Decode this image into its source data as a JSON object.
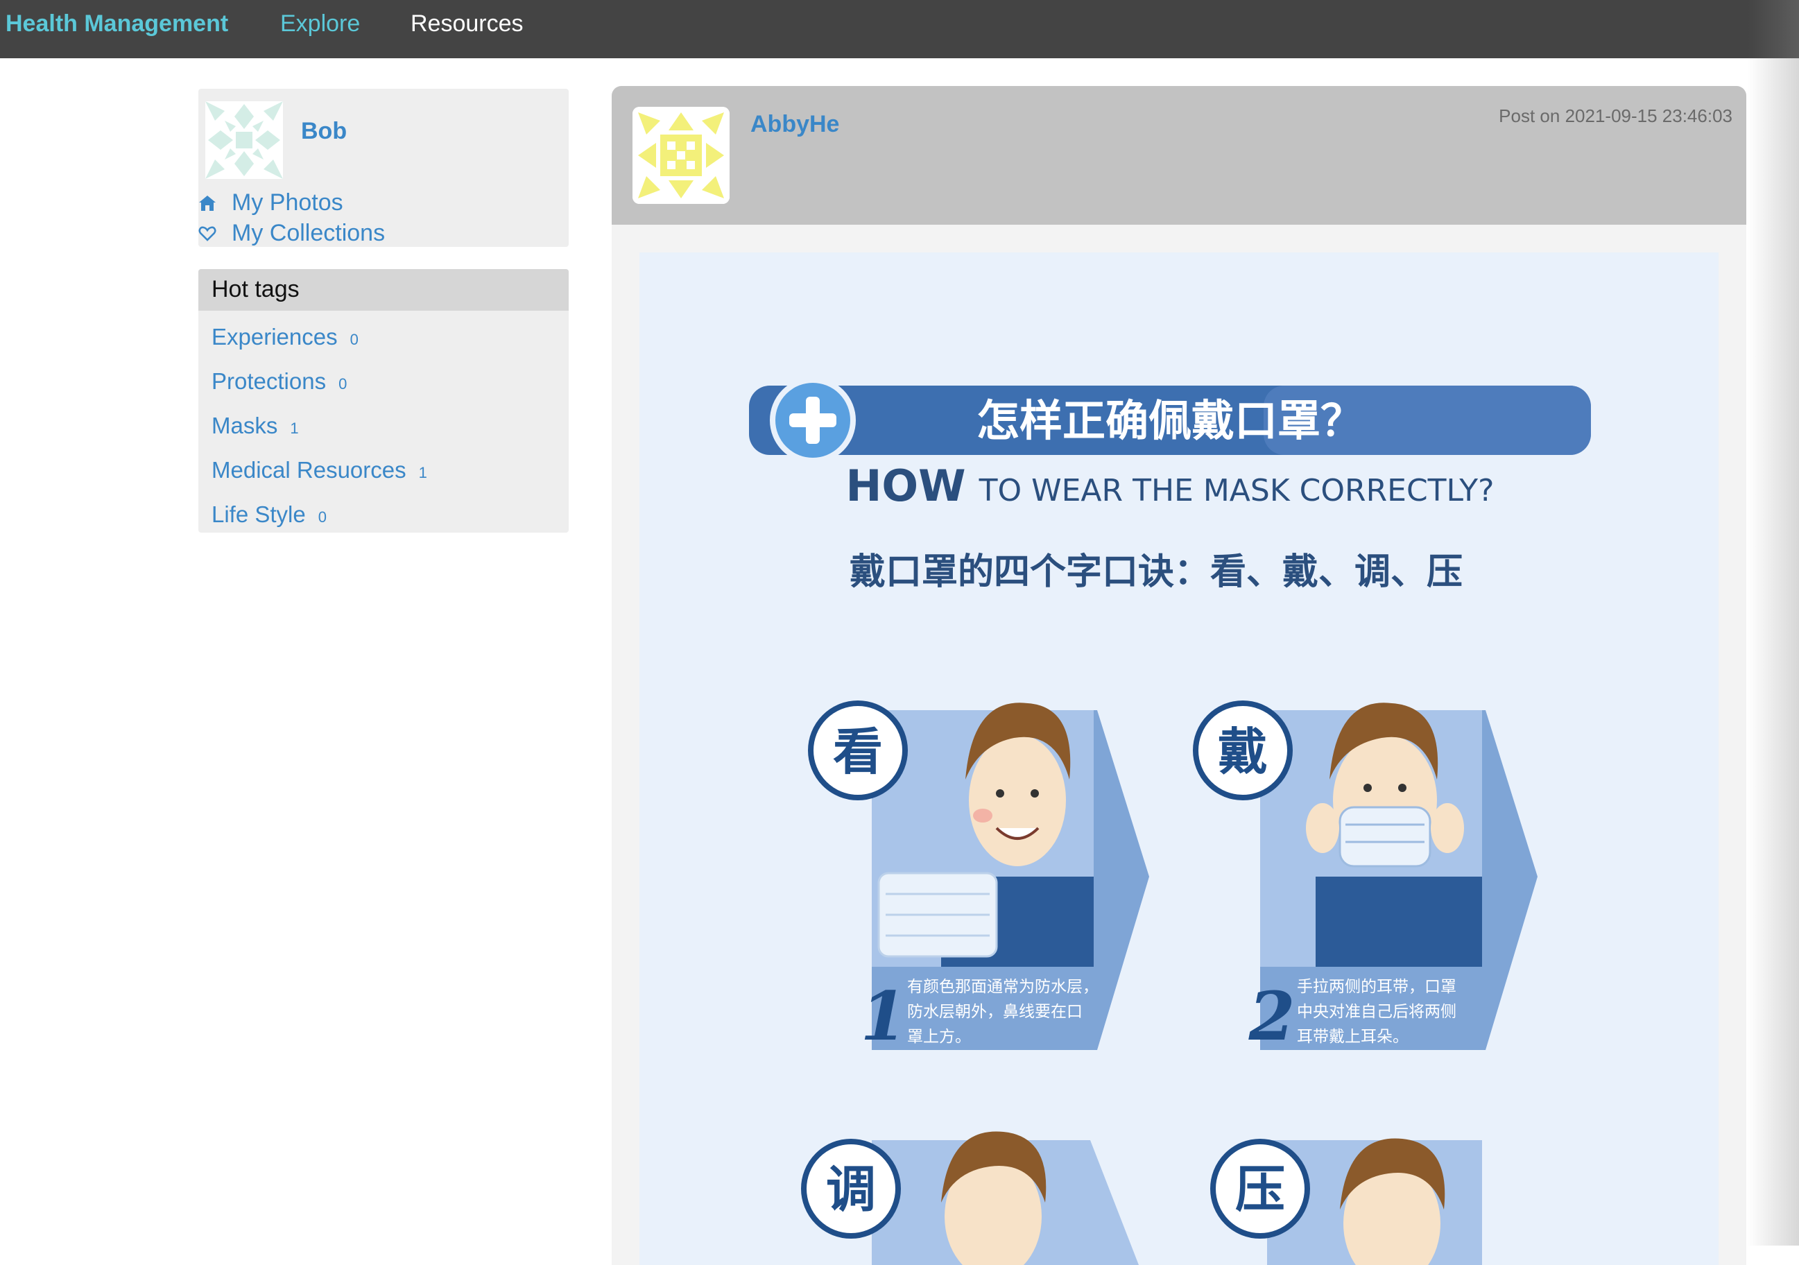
{
  "nav": {
    "brand": "Health Management",
    "items": [
      {
        "label": "Explore"
      },
      {
        "label": "Resources"
      }
    ]
  },
  "sidebar": {
    "user": {
      "name": "Bob"
    },
    "links": [
      {
        "label": "My Photos",
        "icon": "home-icon"
      },
      {
        "label": "My Collections",
        "icon": "heart-icon"
      }
    ],
    "hot_tags": {
      "title": "Hot tags",
      "tags": [
        {
          "name": "Experiences",
          "count": "0"
        },
        {
          "name": "Protections",
          "count": "0"
        },
        {
          "name": "Masks",
          "count": "1"
        },
        {
          "name": "Medical Resuorces",
          "count": "1"
        },
        {
          "name": "Life Style",
          "count": "0"
        }
      ]
    }
  },
  "post": {
    "author": "AbbyHe",
    "timestamp": "Post on 2021-09-15 23:46:03",
    "image": {
      "title_cn": "怎样正确佩戴口罩？",
      "title_en_big": "HOW",
      "title_en_rest": "TO WEAR THE MASK CORRECTLY?",
      "subtitle": "戴口罩的四个字口诀：看、戴、调、压",
      "steps": [
        {
          "char": "看",
          "num": "1",
          "text_lines": [
            "有颜色那面通常为防水层，",
            "防水层朝外，鼻线要在口",
            "罩上方。"
          ]
        },
        {
          "char": "戴",
          "num": "2",
          "text_lines": [
            "手拉两侧的耳带，口罩",
            "中央对准自己后将两侧",
            "耳带戴上耳朵。"
          ]
        },
        {
          "char": "调"
        },
        {
          "char": "压"
        }
      ]
    }
  },
  "colors": {
    "nav_bg": "#444444",
    "brand": "#5bc8d8",
    "link": "#3a87c8",
    "card_bg": "#eeeeee",
    "post_header_bg": "#c2c2c2",
    "poster_blue": "#2b5d95",
    "poster_bg": "#e9f1fb"
  }
}
